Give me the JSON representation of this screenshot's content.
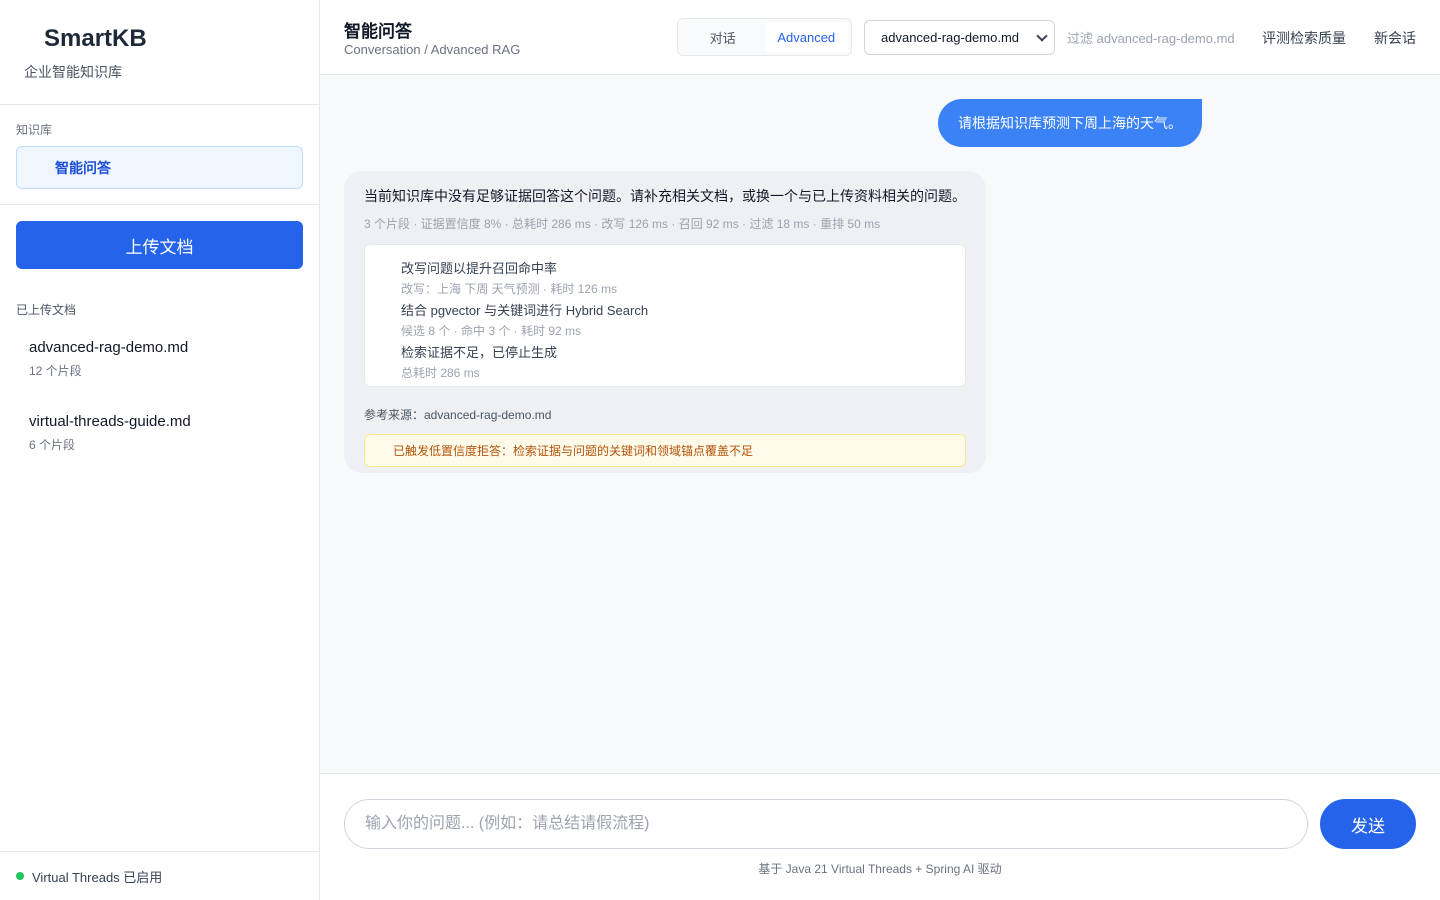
{
  "brand": {
    "title": "SmartKB",
    "subtitle": "企业智能知识库"
  },
  "sidebar": {
    "kb_label": "知识库",
    "kb_item": "智能问答",
    "upload_label": "上传文档",
    "docs_label": "已上传文档",
    "documents": [
      {
        "name": "advanced-rag-demo.md",
        "meta": "12 个片段"
      },
      {
        "name": "virtual-threads-guide.md",
        "meta": "6 个片段"
      }
    ],
    "footer_status": "Virtual Threads 已启用"
  },
  "header": {
    "title": "智能问答",
    "breadcrumb": "Conversation / Advanced RAG",
    "tabs": [
      {
        "label": "对话",
        "active": false
      },
      {
        "label": "Advanced",
        "active": true
      }
    ],
    "selected_document": "advanced-rag-demo.md",
    "filter_text": "过滤 advanced-rag-demo.md",
    "eval_link": "评测检索质量",
    "new_chat_link": "新会话"
  },
  "chat": {
    "user_message": "请根据知识库预测下周上海的天气。",
    "answer": "当前知识库中没有足够证据回答这个问题。请补充相关文档，或换一个与已上传资料相关的问题。",
    "meta": "3 个片段 · 证据置信度 8% · 总耗时 286 ms · 改写 126 ms · 召回 92 ms · 过滤 18 ms · 重排 50 ms",
    "steps": [
      {
        "title": "改写问题以提升召回命中率",
        "detail": "改写：上海 下周 天气预测 · 耗时 126 ms"
      },
      {
        "title": "结合 pgvector 与关键词进行 Hybrid Search",
        "detail": "候选 8 个 · 命中 3 个 · 耗时 92 ms"
      },
      {
        "title": "检索证据不足，已停止生成",
        "detail": "总耗时 286 ms"
      }
    ],
    "source": "参考来源：advanced-rag-demo.md",
    "warning": "已触发低置信度拒答：检索证据与问题的关键词和领域锚点覆盖不足"
  },
  "input": {
    "placeholder": "输入你的问题... (例如：请总结请假流程)",
    "send_label": "发送",
    "powered_by": "基于 Java 21 Virtual Threads + Spring AI 驱动"
  },
  "colors": {
    "primary": "#2563eb",
    "user_bubble": "#3b82f6",
    "status_green": "#22c55e",
    "warning_text": "#b45309"
  },
  "icons": {
    "status": "status-dot-icon",
    "select": "chevron-down-icon"
  }
}
